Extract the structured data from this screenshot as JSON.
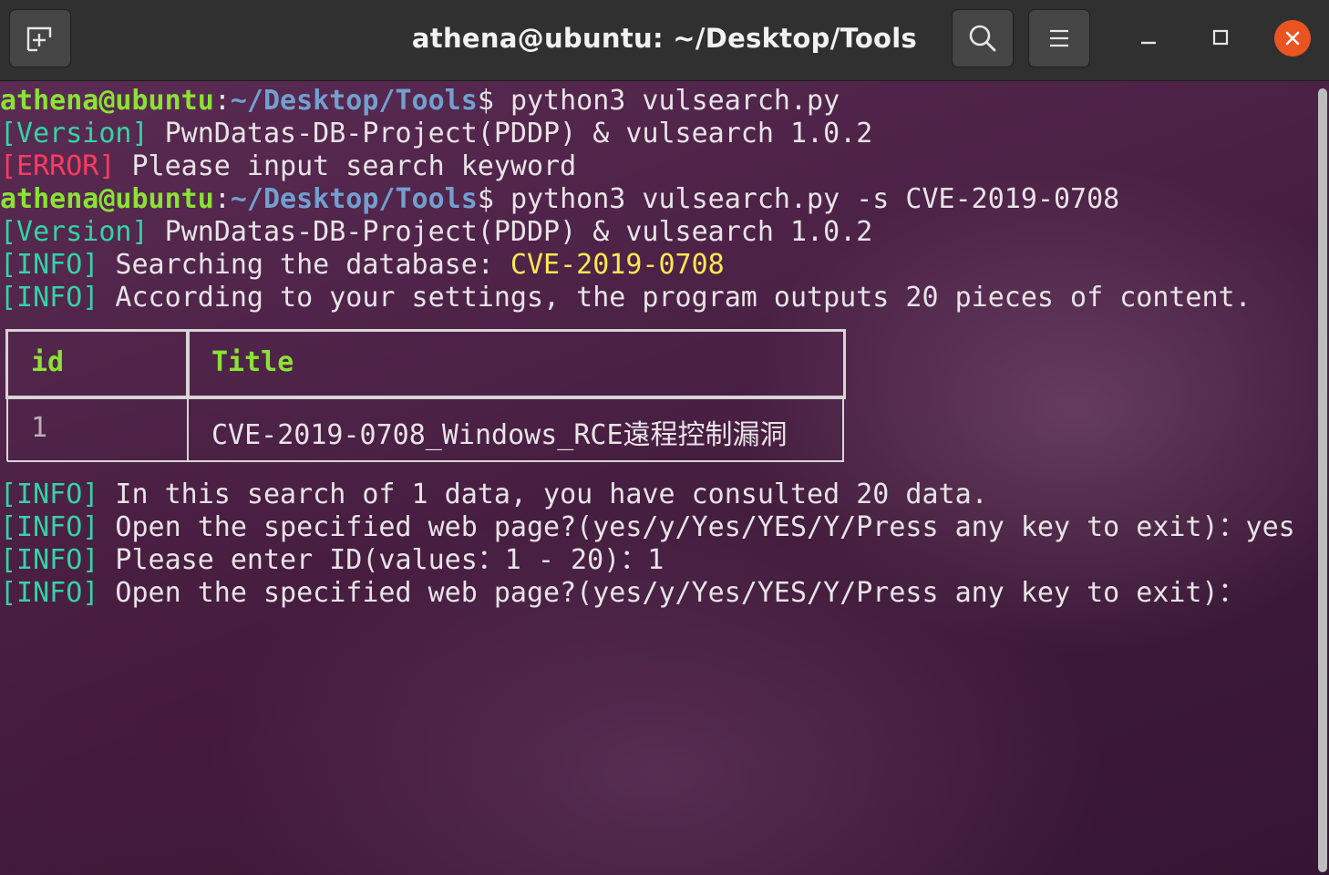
{
  "window": {
    "title": "athena@ubuntu: ~/Desktop/Tools"
  },
  "header_buttons": {
    "new_tab_icon": "new-tab-icon",
    "search_icon": "search-icon",
    "menu_icon": "hamburger-menu-icon",
    "minimize_icon": "minimize-icon",
    "maximize_icon": "maximize-icon",
    "close_icon": "close-icon"
  },
  "colors": {
    "prompt_user": "#8ae234",
    "prompt_path": "#729fcf",
    "tag_info": "#34d3a5",
    "tag_error": "#ff3b5c",
    "highlight": "#fce94f",
    "close_button": "#e95420"
  },
  "terminal": {
    "lines": [
      {
        "user": "athena@ubuntu",
        "sep": ":",
        "path": "~/Desktop/Tools",
        "dollar": "$ ",
        "cmd": "python3 vulsearch.py"
      },
      {
        "tag": "[Version]",
        "text": " PwnDatas-DB-Project(PDDP) & vulsearch 1.0.2"
      },
      {
        "tag": "[ERROR]",
        "text": " Please input search keyword"
      },
      {
        "user": "athena@ubuntu",
        "sep": ":",
        "path": "~/Desktop/Tools",
        "dollar": "$ ",
        "cmd": "python3 vulsearch.py -s CVE-2019-0708"
      },
      {
        "tag": "[Version]",
        "text": " PwnDatas-DB-Project(PDDP) & vulsearch 1.0.2"
      },
      {
        "tag": "[INFO]",
        "text": " Searching the database: ",
        "highlight": "CVE-2019-0708"
      },
      {
        "tag": "[INFO]",
        "text": " According to your settings, the program outputs 20 pieces of content."
      },
      {
        "tag": "[INFO]",
        "text": " In this search of 1 data, you have consulted 20 data."
      },
      {
        "tag": "[INFO]",
        "text": " Open the specified web page?(yes/y/Yes/YES/Y/Press any key to exit)：yes"
      },
      {
        "tag": "[INFO]",
        "text": " Please enter ID(values：1 - 20)：1"
      },
      {
        "tag": "[INFO]",
        "text": " Open the specified web page?(yes/y/Yes/YES/Y/Press any key to exit)："
      }
    ],
    "table": {
      "headers": [
        "id",
        "Title"
      ],
      "rows": [
        [
          "1",
          "CVE-2019-0708_Windows_RCE遠程控制漏洞"
        ]
      ]
    }
  }
}
